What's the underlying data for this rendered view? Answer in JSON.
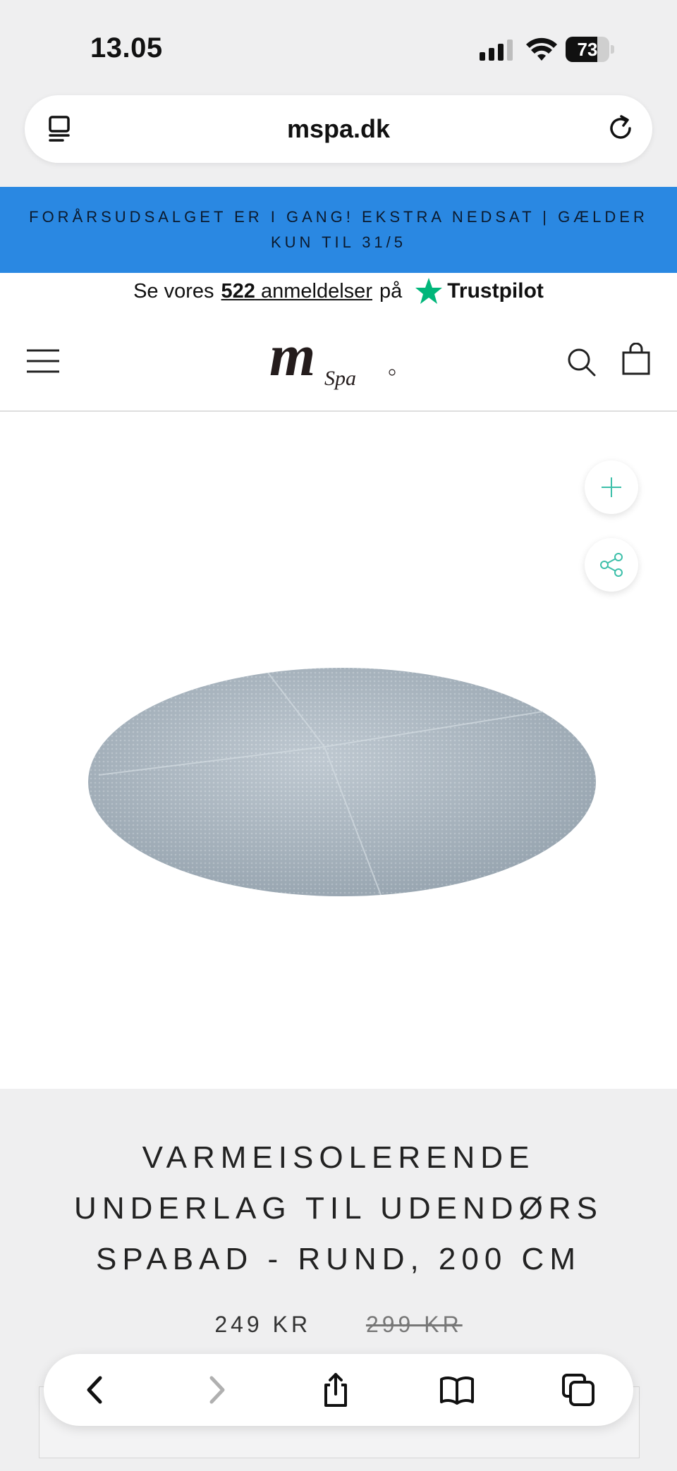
{
  "status_bar": {
    "time": "13.05",
    "battery": "73",
    "battery_level": 0.73
  },
  "browser": {
    "url": "mspa.dk"
  },
  "announcement": {
    "text": "FORÅRSUDSALGET ER I GANG! EKSTRA NEDSAT | GÆLDER KUN TIL 31/5"
  },
  "trust_bar": {
    "prefix": "Se vores",
    "count": "522",
    "reviews_label": "anmeldelser",
    "suffix": "på",
    "brand": "Trustpilot",
    "star_color": "#00b67a"
  },
  "header": {
    "logo_text": "m",
    "logo_sub": "Spa",
    "icons": [
      "hamburger-menu-icon",
      "search-icon",
      "shopping-bag-icon"
    ]
  },
  "gallery": {
    "image_alt": "Round grey insulating underlay",
    "buttons": [
      "zoom-plus-icon",
      "share-icon"
    ],
    "accent_color": "#3cbfa9"
  },
  "product": {
    "title": "VARMEISOLERENDE UNDERLAG TIL UDENDØRS SPABAD - RUND, 200 CM",
    "price": "249 KR",
    "compare_price": "299 KR"
  },
  "toolbar": {
    "icons": [
      "back-chevron-icon",
      "forward-chevron-icon",
      "share-icon",
      "bookmarks-icon",
      "tabs-icon"
    ]
  },
  "colors": {
    "announcement_bg": "#2a88e2",
    "chrome_bg": "#efeff0"
  }
}
